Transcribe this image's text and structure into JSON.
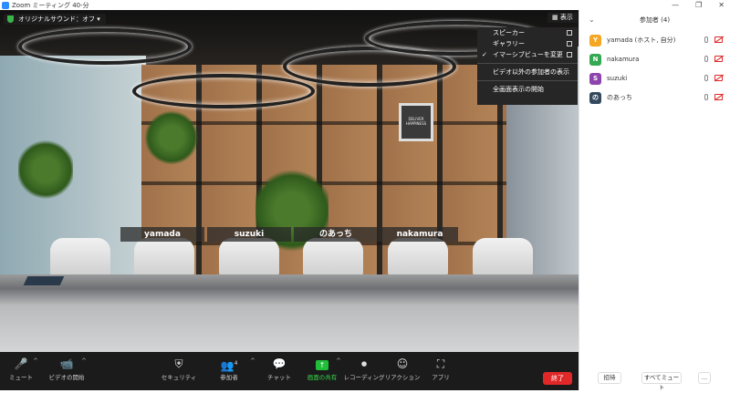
{
  "window": {
    "title": "Zoom ミーティング 40-分",
    "controls": [
      "—",
      "❐",
      "✕"
    ]
  },
  "meeting": {
    "sound_label": "オリジナルサウンド：オフ ▾",
    "view_label": "▦ 表示",
    "name_tags": [
      "yamada",
      "suzuki",
      "のあっち",
      "nakamura"
    ],
    "poster_text": "DELIVER HAPPINESS"
  },
  "view_menu": {
    "items": [
      {
        "label": "スピーカー",
        "checked": ""
      },
      {
        "label": "ギャラリー",
        "checked": ""
      },
      {
        "label": "イマーシブビューを変更",
        "checked": "✓"
      },
      {
        "label": "ビデオ以外の参加者の表示",
        "checked": ""
      },
      {
        "label": "全画面表示の開始",
        "checked": ""
      }
    ]
  },
  "toolbar": {
    "mute": {
      "label": "ミュート",
      "icon": "🎤"
    },
    "video": {
      "label": "ビデオの開始",
      "icon": "📹"
    },
    "security": {
      "label": "セキュリティ",
      "icon": "⛨"
    },
    "participants": {
      "label": "参加者",
      "icon": "👥",
      "count": "4"
    },
    "chat": {
      "label": "チャット",
      "icon": "💬"
    },
    "share": {
      "label": "画面の共有",
      "icon": "↑"
    },
    "record": {
      "label": "レコーディング",
      "icon": "⏺"
    },
    "reactions": {
      "label": "リアクション",
      "icon": "☺"
    },
    "apps": {
      "label": "アプリ",
      "icon": "⛶"
    },
    "end_label": "終了"
  },
  "participants_panel": {
    "title": "参加者 (4)",
    "chevron": "⌄",
    "participants": [
      {
        "initial": "Y",
        "name": "yamada (ホスト, 自分)",
        "color": "#f5a623"
      },
      {
        "initial": "N",
        "name": "nakamura",
        "color": "#34a853"
      },
      {
        "initial": "S",
        "name": "suzuki",
        "color": "#8e44ad"
      },
      {
        "initial": "の",
        "name": "のあっち",
        "color": "#34495e"
      }
    ],
    "footer": {
      "invite": "招待",
      "mute_all": "すべてミュート",
      "more": "..."
    }
  }
}
